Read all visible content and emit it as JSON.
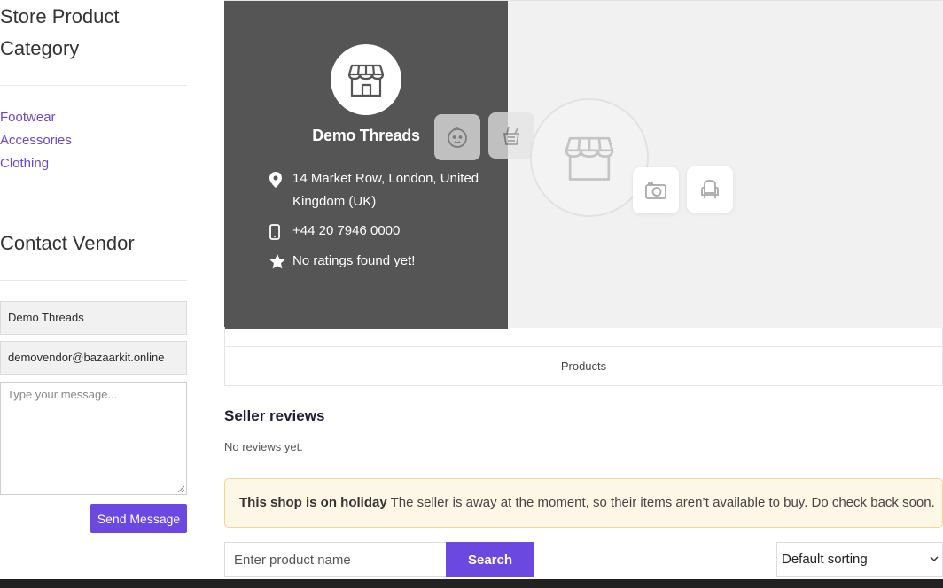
{
  "sidebar": {
    "category_title": "Store Product Category",
    "categories": [
      {
        "label": "Footwear"
      },
      {
        "label": "Accessories"
      },
      {
        "label": "Clothing"
      }
    ],
    "contact_title": "Contact Vendor",
    "name_value": "Demo Threads",
    "email_value": "demovendor@bazaarkit.online",
    "message_placeholder": "Type your message...",
    "send_label": "Send Message"
  },
  "store": {
    "name": "Demo Threads",
    "address": "14 Market Row, London, United Kingdom (UK)",
    "phone": "+44 20 7946 0000",
    "rating": "No ratings found yet!"
  },
  "tabs": {
    "products_label": "Products"
  },
  "reviews": {
    "title": "Seller reviews",
    "empty_text": "No reviews yet."
  },
  "notice": {
    "title": "This shop is on holiday",
    "text": "The seller is away at the moment, so their items aren’t available to buy. Do check back soon."
  },
  "search": {
    "placeholder": "Enter product name",
    "button_label": "Search"
  },
  "sort": {
    "selected": "Default sorting"
  },
  "colors": {
    "accent": "#6b48e0",
    "link": "#6b48c9",
    "store_card": "#555555",
    "notice_bg": "#fdf7e6"
  }
}
